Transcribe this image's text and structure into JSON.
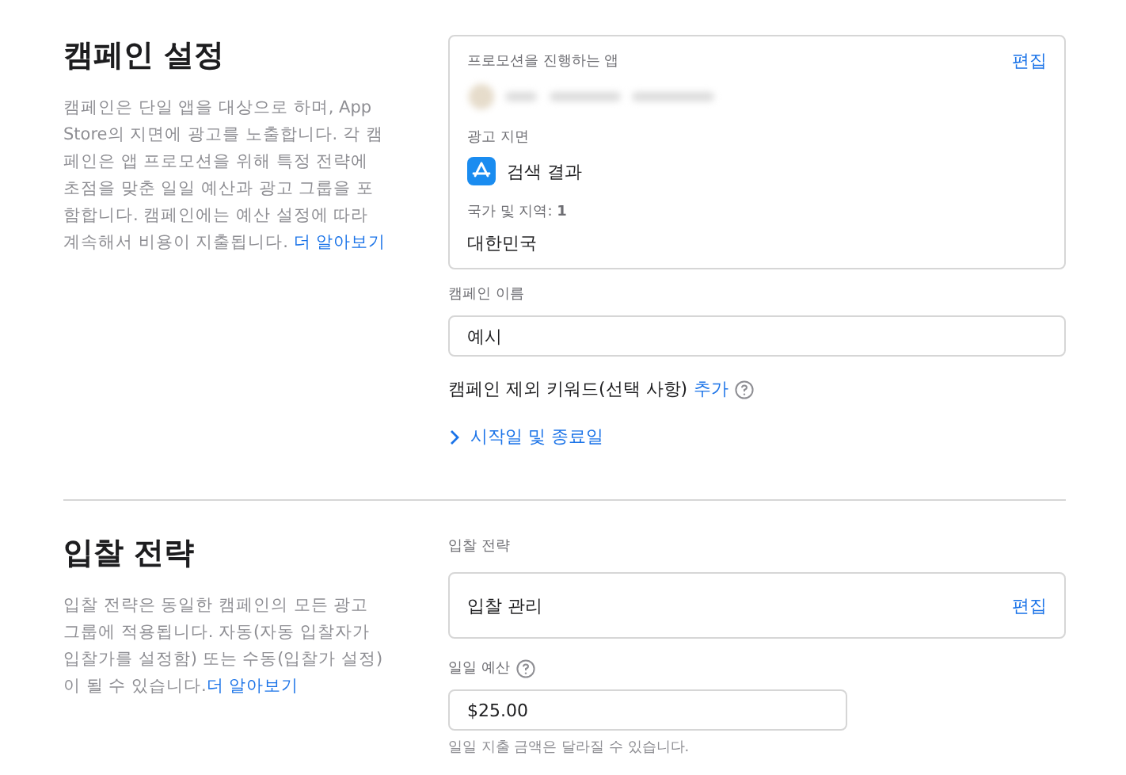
{
  "campaign_settings": {
    "title": "캠페인 설정",
    "description": "캠페인은 단일 앱을 대상으로 하며, App Store의 지면에 광고를 노출합니다. 각 캠페인은 앱 프로모션을 위해 특정 전략에 초점을 맞춘 일일 예산과 광고 그룹을 포함합니다. 캠페인에는 예산 설정에 따라 계속해서 비용이 지출됩니다.",
    "learn_more": "더 알아보기",
    "summary": {
      "app_label": "프로모션을 진행하는 앱",
      "edit": "편집",
      "placement_label": "광고 지면",
      "placement": "검색 결과",
      "countries_label": "국가 및 지역: **1**",
      "country": "대한민국"
    },
    "name_label": "캠페인 이름",
    "name_value": "예시",
    "negative_keywords_label": "캠페인 제외 키워드(선택 사항)",
    "negative_keywords_add": "추가",
    "dates_toggle": {
      "label": "시작일 및 종료일",
      "expanded": false
    }
  },
  "bid_strategy": {
    "title": "입찰 전략",
    "description": "입찰 전략은 동일한 캠페인의 모든 광고 그룹에 적용됩니다. 자동(자동 입찰자가 입찰가를 설정함) 또는 수동(입찰가 설정)이 될 수 있습니다.",
    "learn_more": "더 알아보기",
    "strategy_label": "입찰 전략",
    "strategy_value": "입찰 관리",
    "edit": "편집",
    "budget_label": "일일 예산",
    "budget_value": "$25.00",
    "budget_note": "일일 지출 금액은 달라질 수 있습니다."
  }
}
